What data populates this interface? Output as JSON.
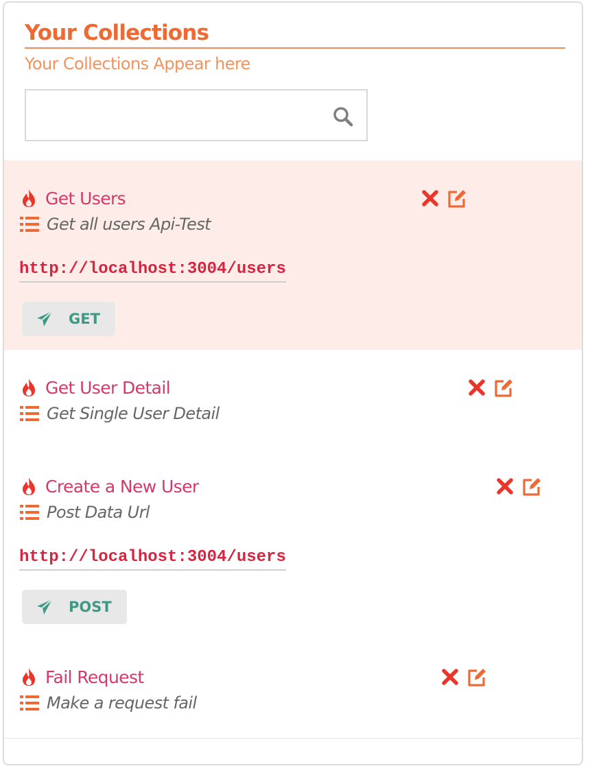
{
  "header": {
    "title": "Your Collections",
    "subtitle": "Your Collections Appear here"
  },
  "search": {
    "value": "",
    "placeholder": ""
  },
  "colors": {
    "accent": "#ee6a35",
    "item_title": "#d23a6b",
    "url": "#d9233f",
    "method": "#3e9984",
    "active_bg": "#fdece7",
    "delete": "#e8362b"
  },
  "icons": {
    "title": "flame-icon",
    "description": "list-icon",
    "delete": "times-icon",
    "edit": "edit-icon",
    "method": "paper-plane-icon",
    "search": "search-icon"
  },
  "collections": [
    {
      "title": "Get Users",
      "description": "Get all users Api-Test",
      "url": "http://localhost:3004/users",
      "method": "GET",
      "selected": true
    },
    {
      "title": "Get User Detail",
      "description": "Get Single User Detail"
    },
    {
      "title": "Create a New User",
      "description": "Post Data Url",
      "url": "http://localhost:3004/users",
      "method": "POST"
    },
    {
      "title": "Fail Request",
      "description": "Make a request fail"
    }
  ]
}
